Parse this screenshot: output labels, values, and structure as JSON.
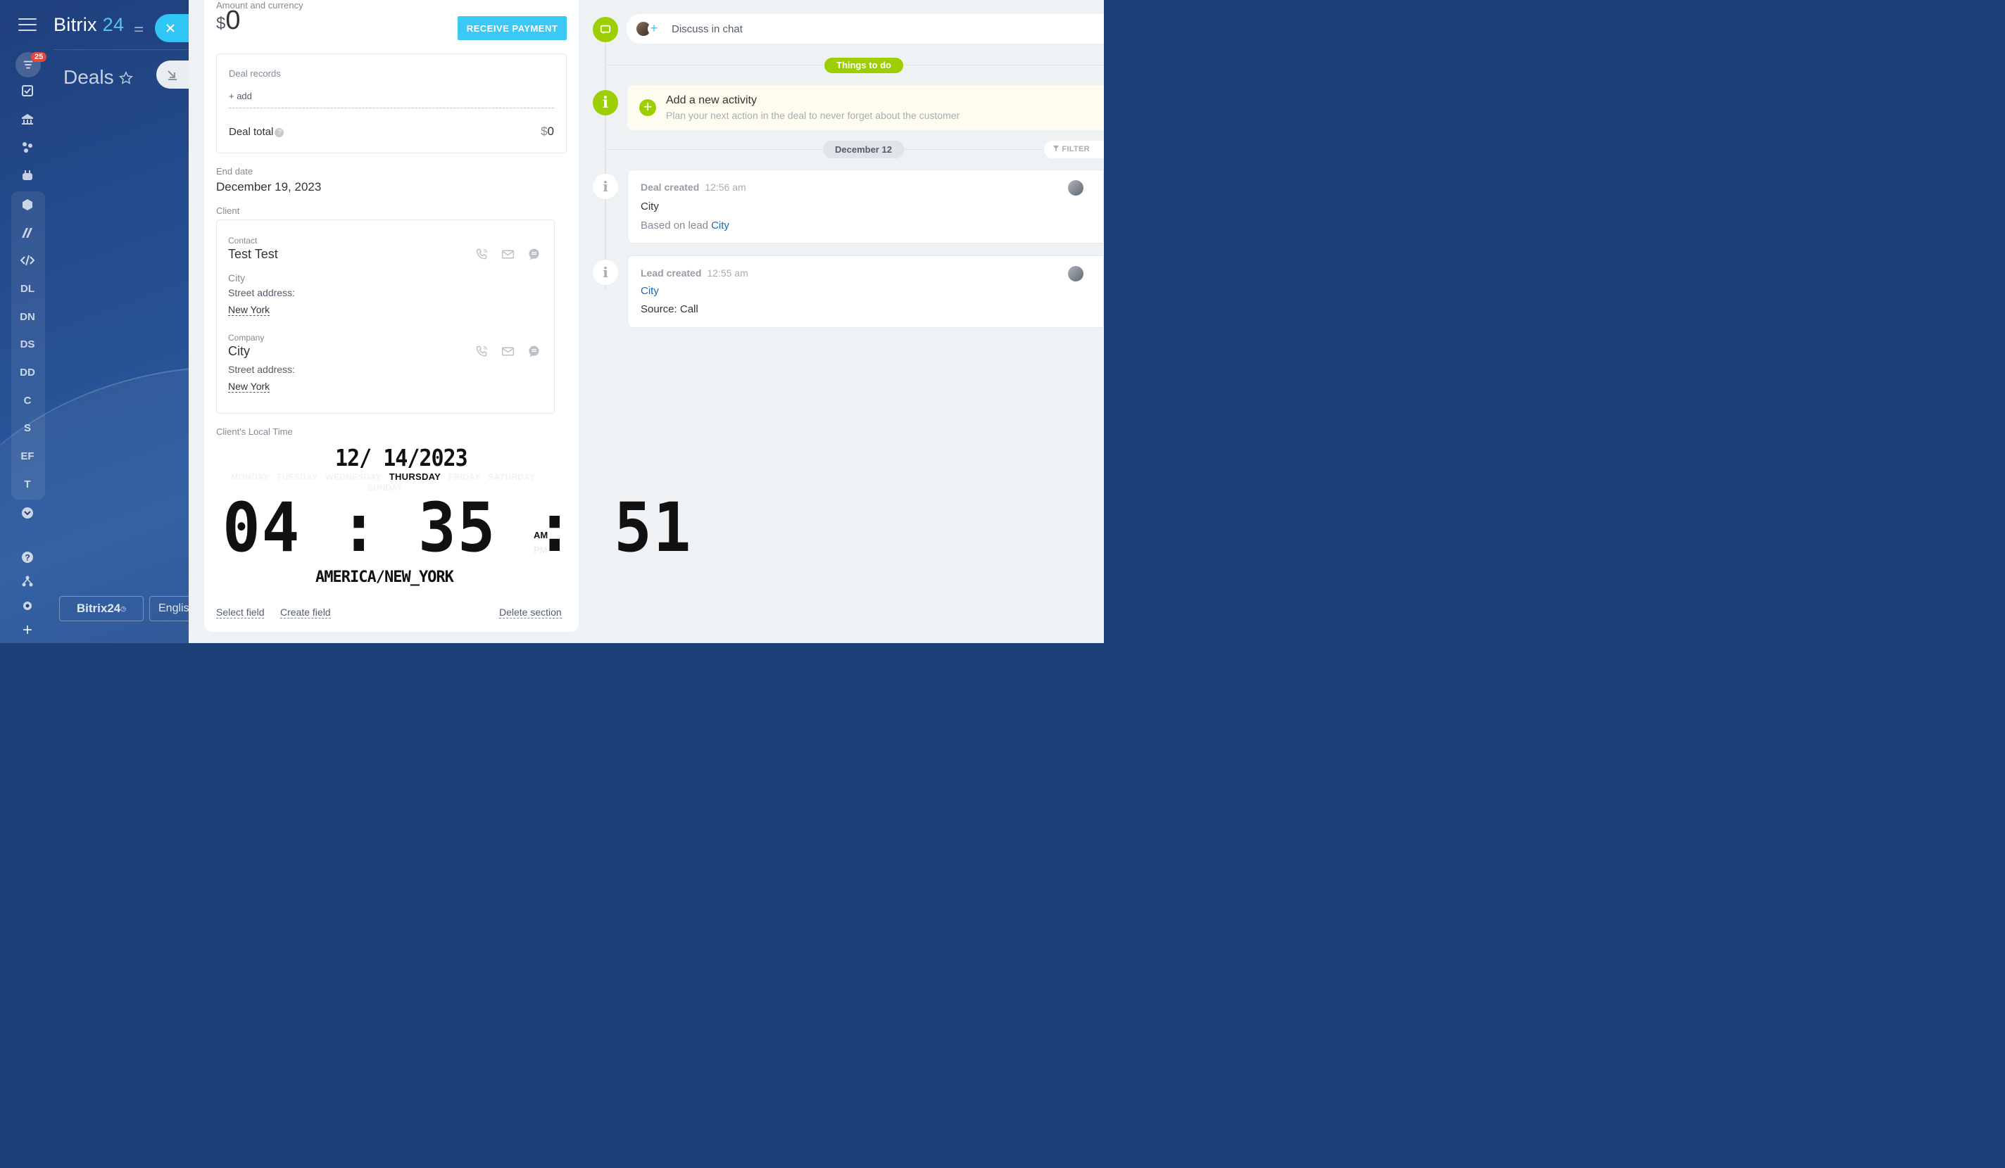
{
  "portal": {
    "brand_name": "Bitrix",
    "brand_num": "24",
    "page_title": "Deals",
    "counter_badge": "25",
    "rail_letters": [
      "DL",
      "DN",
      "DS",
      "DD",
      "C",
      "S",
      "EF",
      "T"
    ],
    "bottom_logo": "Bitrix24",
    "language": "English"
  },
  "deal": {
    "amount_label": "Amount and currency",
    "currency_symbol": "$",
    "amount_value": "0",
    "receive_payment": "RECEIVE PAYMENT",
    "records_label": "Deal records",
    "add_link": "+ add",
    "deal_total_label": "Deal total",
    "deal_total_value": "0",
    "end_date_label": "End date",
    "end_date_value": "December 19, 2023",
    "client_label": "Client"
  },
  "client": {
    "contact_type": "Contact",
    "contact_name": "Test Test",
    "contact_sub": "City",
    "contact_addr_label": "Street address:",
    "contact_addr_link": "New York",
    "company_type": "Company",
    "company_name": "City",
    "company_addr_label": "Street address:",
    "company_addr_link": "New York"
  },
  "clock": {
    "label": "Client's Local Time",
    "date": "12/ 14/2023",
    "weekdays": [
      "MONDAY",
      "TUESDAY",
      "WEDNESDAY",
      "THURSDAY",
      "FRIDAY",
      "SATURDAY"
    ],
    "sunday": "SUNDAY",
    "active_weekday": "THURSDAY",
    "time": "04 : 35 : 51",
    "am": "AM",
    "pm": "PM",
    "timezone": "AMERICA/NEW_YORK"
  },
  "footer": {
    "select_field": "Select field",
    "create_field": "Create field",
    "delete_section": "Delete section"
  },
  "timeline": {
    "discuss_chat": "Discuss in chat",
    "things_to_do": "Things to do",
    "activity_title": "Add a new activity",
    "activity_sub": "Plan your next action in the deal to never forget about the customer",
    "date_pill": "December 12",
    "filter": "FILTER",
    "events": [
      {
        "title": "Deal created",
        "time": "12:56 am",
        "line1": "City",
        "line2_prefix": "Based on lead",
        "line2_link": "City"
      },
      {
        "title": "Lead created",
        "time": "12:55 am",
        "line1_link": "City",
        "line2": "Source: Call"
      }
    ]
  },
  "colors": {
    "accent_blue": "#3bc8f5",
    "green": "#9dcf00",
    "link": "#2067b0"
  }
}
